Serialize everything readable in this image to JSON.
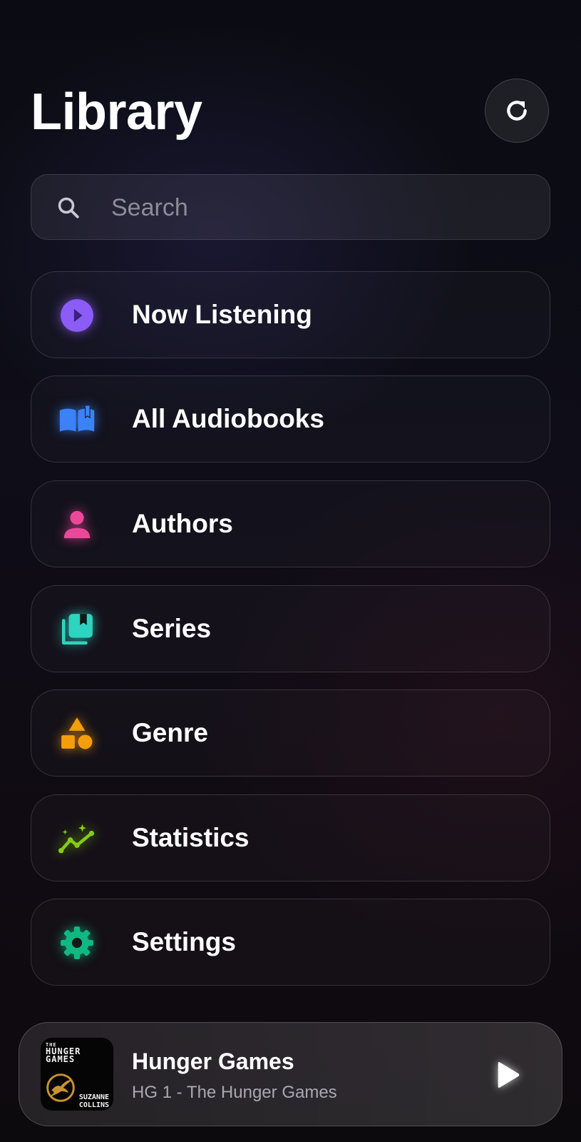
{
  "header": {
    "title": "Library",
    "refresh_icon": "refresh-icon"
  },
  "search": {
    "placeholder": "Search",
    "value": "",
    "icon": "search-icon"
  },
  "menu": {
    "items": [
      {
        "label": "Now Listening",
        "icon": "play-circle-icon",
        "color": "#8B5CF6"
      },
      {
        "label": "All Audiobooks",
        "icon": "open-book-icon",
        "color": "#3B82F6"
      },
      {
        "label": "Authors",
        "icon": "person-icon",
        "color": "#EC4899"
      },
      {
        "label": "Series",
        "icon": "stacked-bookmarks-icon",
        "color": "#2DD4BF"
      },
      {
        "label": "Genre",
        "icon": "shapes-icon",
        "color": "#F59E0B"
      },
      {
        "label": "Statistics",
        "icon": "sparkline-chart-icon",
        "color": "#84CC16"
      },
      {
        "label": "Settings",
        "icon": "gear-icon",
        "color": "#10B981"
      }
    ]
  },
  "mini_player": {
    "title": "Hunger Games",
    "subtitle": "HG 1 - The Hunger Games",
    "cover": {
      "small_text": "THE",
      "title_line1": "HUNGER",
      "title_line2": "GAMES",
      "author_line1": "SUZANNE",
      "author_line2": "COLLINS"
    },
    "play_icon": "play-icon"
  }
}
